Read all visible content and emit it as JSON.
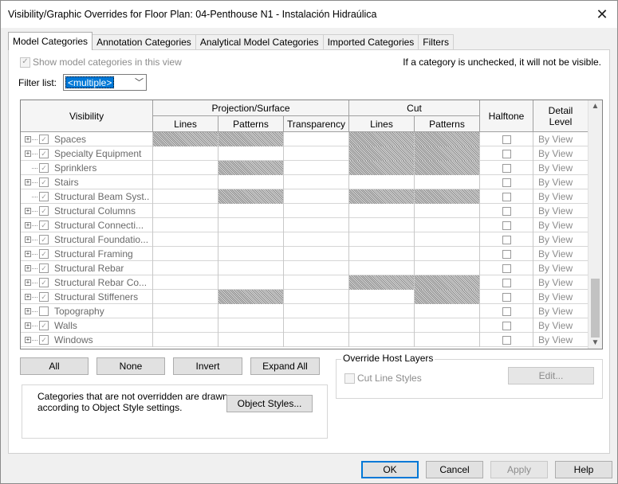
{
  "window": {
    "title": "Visibility/Graphic Overrides for Floor Plan: 04-Penthouse N1 - Instalación Hidraúlica",
    "close_glyph": "✕"
  },
  "tabs": [
    {
      "label": "Model Categories",
      "active": true
    },
    {
      "label": "Annotation Categories"
    },
    {
      "label": "Analytical Model Categories"
    },
    {
      "label": "Imported Categories"
    },
    {
      "label": "Filters"
    }
  ],
  "show_model": {
    "label": "Show model categories in this view",
    "checked": true
  },
  "hint": "If a category is unchecked, it will not be visible.",
  "filter": {
    "label": "Filter list:",
    "value": "<multiple>"
  },
  "grid": {
    "headers": {
      "visibility": "Visibility",
      "projection_surface": "Projection/Surface",
      "lines": "Lines",
      "patterns": "Patterns",
      "transparency": "Transparency",
      "cut": "Cut",
      "cut_lines": "Lines",
      "cut_patterns": "Patterns",
      "halftone": "Halftone",
      "detail_level": "Detail Level"
    },
    "rows": [
      {
        "name": "Spaces",
        "expandable": true,
        "checked": true,
        "detail": "By View"
      },
      {
        "name": "Specialty Equipment",
        "expandable": true,
        "checked": true,
        "detail": "By View"
      },
      {
        "name": "Sprinklers",
        "expandable": false,
        "checked": true,
        "detail": "By View"
      },
      {
        "name": "Stairs",
        "expandable": true,
        "checked": true,
        "detail": "By View"
      },
      {
        "name": "Structural Beam Syst...",
        "expandable": false,
        "checked": true,
        "detail": "By View"
      },
      {
        "name": "Structural Columns",
        "expandable": true,
        "checked": true,
        "detail": "By View"
      },
      {
        "name": "Structural Connecti...",
        "expandable": true,
        "checked": true,
        "detail": "By View"
      },
      {
        "name": "Structural Foundatio...",
        "expandable": true,
        "checked": true,
        "detail": "By View"
      },
      {
        "name": "Structural Framing",
        "expandable": true,
        "checked": true,
        "detail": "By View"
      },
      {
        "name": "Structural Rebar",
        "expandable": true,
        "checked": true,
        "detail": "By View"
      },
      {
        "name": "Structural Rebar Co...",
        "expandable": true,
        "checked": true,
        "detail": "By View"
      },
      {
        "name": "Structural Stiffeners",
        "expandable": true,
        "checked": true,
        "detail": "By View"
      },
      {
        "name": "Topography",
        "expandable": true,
        "checked": false,
        "detail": "By View"
      },
      {
        "name": "Walls",
        "expandable": true,
        "checked": true,
        "detail": "By View"
      },
      {
        "name": "Windows",
        "expandable": true,
        "checked": true,
        "detail": "By View"
      }
    ]
  },
  "buttons": {
    "all": "All",
    "none": "None",
    "invert": "Invert",
    "expand_all": "Expand All",
    "object_styles": "Object Styles...",
    "edit": "Edit...",
    "ok": "OK",
    "cancel": "Cancel",
    "apply": "Apply",
    "help": "Help"
  },
  "note": "Categories that are not overridden are drawn according to Object Style settings.",
  "override_host": {
    "title": "Override Host Layers",
    "cut_line_styles": "Cut Line Styles"
  }
}
